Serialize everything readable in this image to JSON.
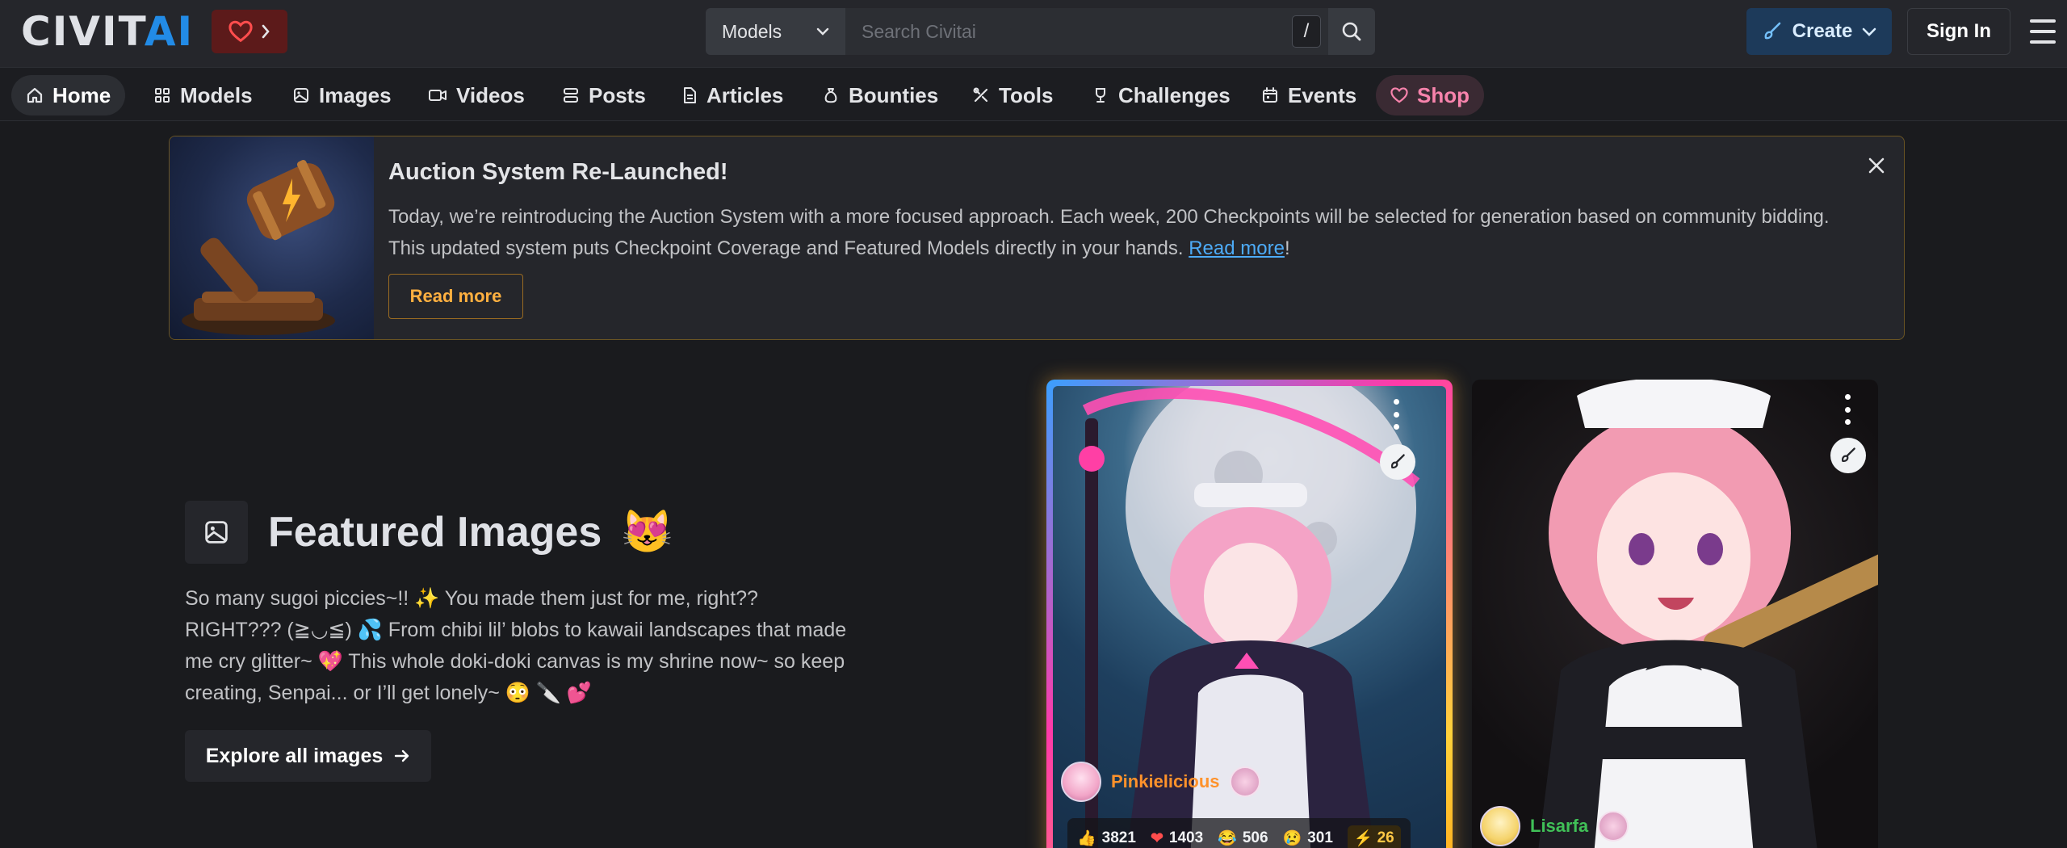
{
  "header": {
    "logo_main": "CIVIT",
    "logo_accent": "AI",
    "search": {
      "category": "Models",
      "placeholder": "Search Civitai",
      "shortcut": "/"
    },
    "create_label": "Create",
    "signin_label": "Sign In"
  },
  "nav": {
    "items": [
      {
        "label": "Home",
        "icon": "home-icon"
      },
      {
        "label": "Models",
        "icon": "grid-icon"
      },
      {
        "label": "Images",
        "icon": "image-icon"
      },
      {
        "label": "Videos",
        "icon": "video-icon"
      },
      {
        "label": "Posts",
        "icon": "posts-icon"
      },
      {
        "label": "Articles",
        "icon": "article-icon"
      },
      {
        "label": "Bounties",
        "icon": "moneybag-icon"
      },
      {
        "label": "Tools",
        "icon": "tools-icon"
      },
      {
        "label": "Challenges",
        "icon": "trophy-icon"
      },
      {
        "label": "Events",
        "icon": "calendar-icon"
      },
      {
        "label": "Shop",
        "icon": "heart-icon"
      }
    ]
  },
  "announcement": {
    "title": "Auction System Re-Launched!",
    "body": "Today, we’re reintroducing the Auction System with a more focused approach. Each week, 200 Checkpoints will be selected for generation based on community bidding. This updated system puts Checkpoint Coverage and Featured Models directly in your hands.",
    "link_text": "Read more",
    "link_suffix": "!",
    "button_label": "Read more"
  },
  "featured": {
    "title": "Featured Images",
    "title_emoji": "😻",
    "description": "So many sugoi piccies~!! ✨ You made them just for me, right?? RIGHT??? (≧◡≦) 💦 From chibi lil’ blobs to kawaii landscapes that made me cry glitter~ 💖 This whole doki-doki canvas is my shrine now~ so keep creating, Senpai... or I’ll get lonely~ 😳 🔪 💕",
    "button_label": "Explore all images"
  },
  "cards": [
    {
      "username": "Pinkielicious",
      "username_color": "#ff922b",
      "reactions": {
        "like": "3821",
        "heart": "1403",
        "laugh": "506",
        "cry": "301"
      },
      "buzz": "26"
    },
    {
      "username": "Lisarfa",
      "username_color": "#40c057"
    }
  ],
  "colors": {
    "background": "#1a1b1e",
    "accent_blue": "#228be6",
    "announcement_border": "#6b5523",
    "link": "#4dabf7"
  }
}
